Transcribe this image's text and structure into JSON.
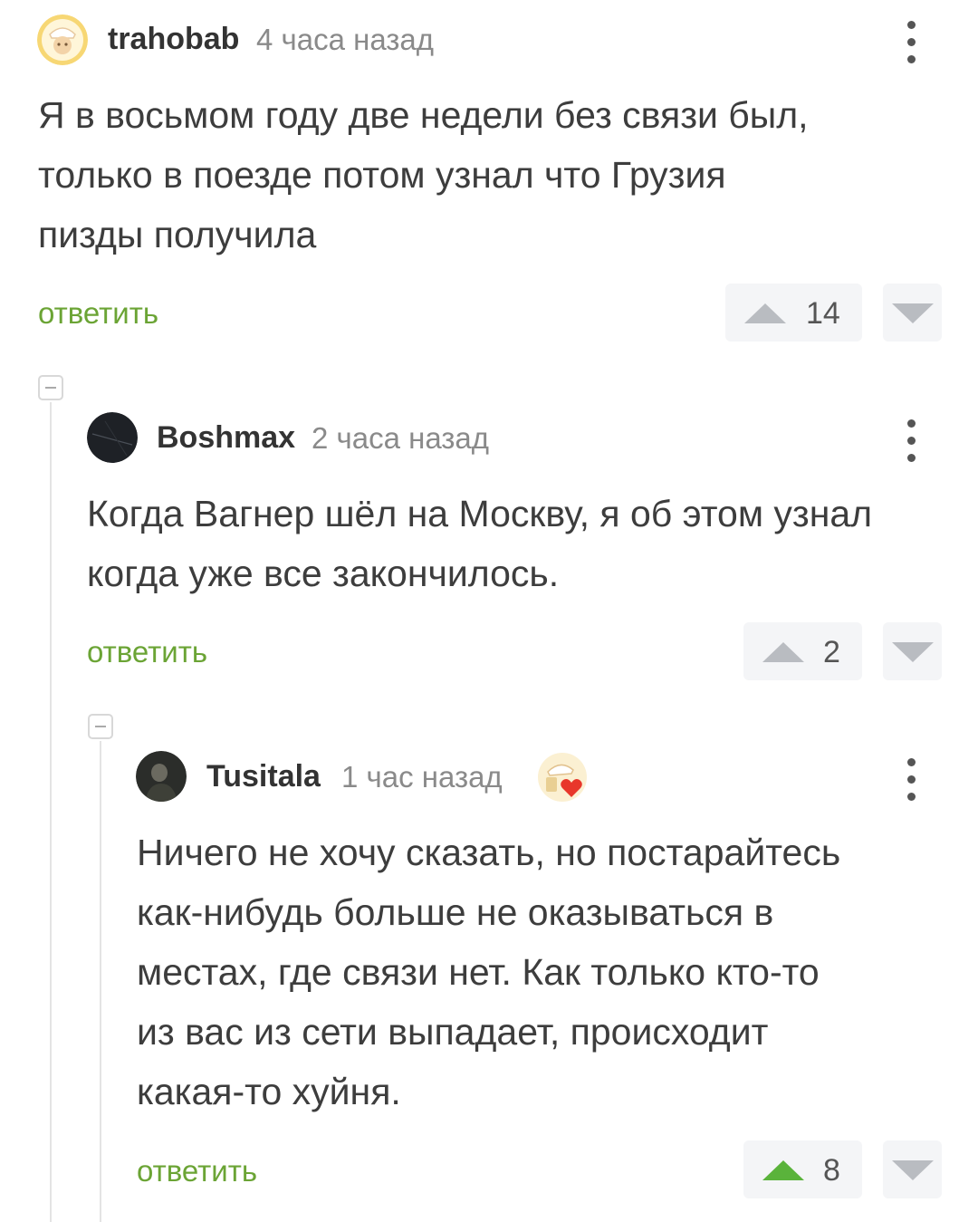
{
  "colors": {
    "accent_green": "#6ba435",
    "upvote_active": "#5ab33b",
    "vote_bg": "#f4f5f7"
  },
  "comments": [
    {
      "user": "trahobab",
      "time": "4 часа назад",
      "lines": [
        "Я в восьмом году две недели без связи был,",
        "только в поезде потом узнал что Грузия",
        "пизды получила"
      ],
      "reply": "ответить",
      "votes": "14",
      "upvoted": false
    },
    {
      "user": "Boshmax",
      "time": "2 часа назад",
      "lines": [
        "Когда Вагнер шёл на Москву, я об этом узнал",
        "когда уже все закончилось."
      ],
      "reply": "ответить",
      "votes": "2",
      "upvoted": false
    },
    {
      "user": "Tusitala",
      "time": "1 час назад",
      "badge": "heart-badge-icon",
      "lines": [
        "Ничего не хочу сказать, но постарайтесь",
        "как-нибудь больше не оказываться в",
        "местах, где связи нет. Как только кто-то",
        "из вас из сети выпадает, происходит",
        "какая-то хуйня."
      ],
      "reply": "ответить",
      "votes": "8",
      "upvoted": true
    }
  ]
}
